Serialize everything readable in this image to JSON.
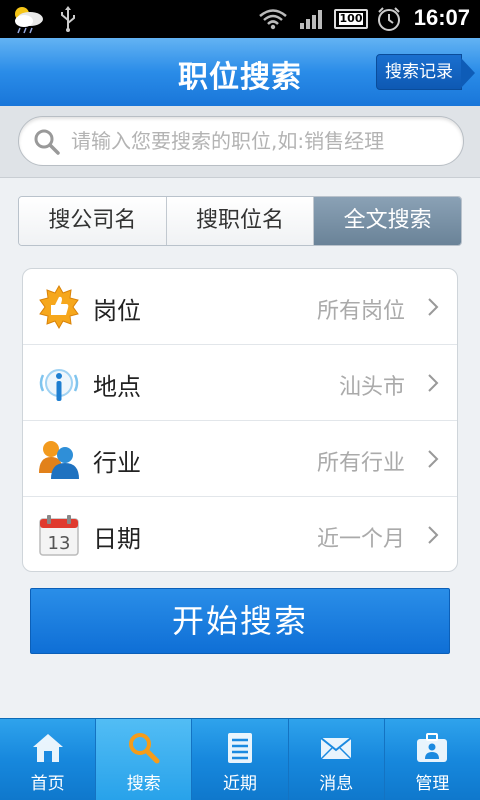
{
  "status_bar": {
    "time": "16:07",
    "battery_level": "100"
  },
  "header": {
    "title": "职位搜索",
    "history_button_label": "搜索记录"
  },
  "search": {
    "placeholder": "请输入您要搜索的职位,如:销售经理",
    "value": ""
  },
  "tabs": [
    {
      "label": "搜公司名",
      "active": false
    },
    {
      "label": "搜职位名",
      "active": false
    },
    {
      "label": "全文搜索",
      "active": true
    }
  ],
  "filters": [
    {
      "label": "岗位",
      "value": "所有岗位",
      "icon": "thumbs-up-icon"
    },
    {
      "label": "地点",
      "value": "汕头市",
      "icon": "location-info-icon"
    },
    {
      "label": "行业",
      "value": "所有行业",
      "icon": "people-icon"
    },
    {
      "label": "日期",
      "value": "近一个月",
      "icon": "calendar-icon"
    }
  ],
  "calendar_day": "13",
  "start_button_label": "开始搜索",
  "bottom_nav": [
    {
      "label": "首页",
      "icon": "home-icon",
      "active": false
    },
    {
      "label": "搜索",
      "icon": "search-icon",
      "active": true
    },
    {
      "label": "近期",
      "icon": "list-icon",
      "active": false
    },
    {
      "label": "消息",
      "icon": "mail-icon",
      "active": false
    },
    {
      "label": "管理",
      "icon": "briefcase-icon",
      "active": false
    }
  ],
  "colors": {
    "header_blue": "#2a8ce8",
    "active_tab": "#6a8398",
    "start_button": "#1a7fe0"
  }
}
